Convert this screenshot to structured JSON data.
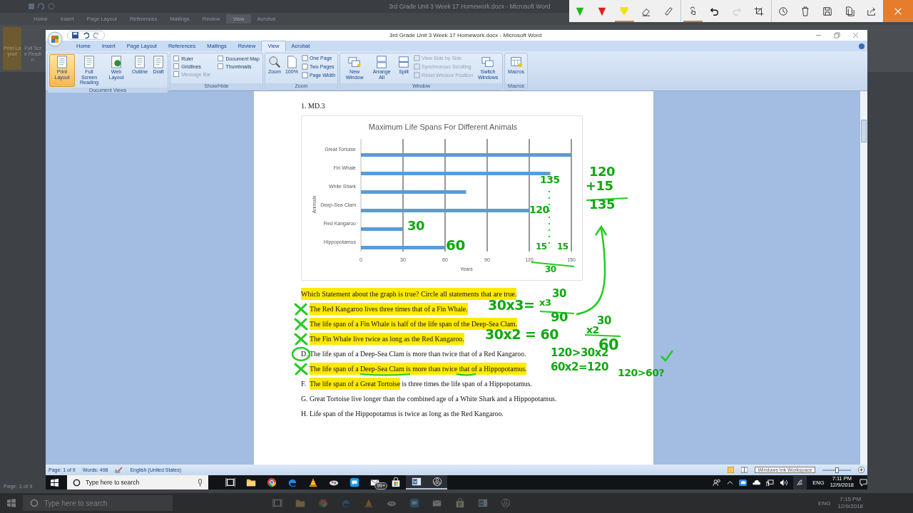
{
  "background": {
    "title": "3rd Grade Unit 3 Week 17 Homework.docx - Microsoft Word",
    "tabs": [
      {
        "label": "Home",
        "selected": false
      },
      {
        "label": "Insert",
        "selected": false
      },
      {
        "label": "Page Layout",
        "selected": false
      },
      {
        "label": "References",
        "selected": false
      },
      {
        "label": "Mailings",
        "selected": false
      },
      {
        "label": "Review",
        "selected": false
      },
      {
        "label": "View",
        "selected": true
      },
      {
        "label": "Acrobat",
        "selected": false
      }
    ],
    "ribbon_buttons": [
      {
        "label": "Print Layout",
        "selected": true
      },
      {
        "label": "Full Scre Readin",
        "selected": false
      }
    ],
    "status": "Page: 1 of 9",
    "search_placeholder": "Type here to search",
    "language": "ENG",
    "time": "7:15 PM",
    "date": "12/9/2018"
  },
  "ink_toolbar": {
    "tools": [
      {
        "kind": "pen",
        "color": "#1fb81f",
        "selected": false
      },
      {
        "kind": "pen",
        "color": "#d9201c",
        "selected": false
      },
      {
        "kind": "highlighter",
        "color": "#f2e400",
        "selected": true
      },
      {
        "kind": "eraser",
        "selected": false
      },
      {
        "kind": "ruler",
        "selected": false
      },
      {
        "kind": "touch",
        "selected": true
      },
      {
        "kind": "undo",
        "disabled": false
      },
      {
        "kind": "redo",
        "disabled": true
      },
      {
        "kind": "crop",
        "selected": false
      },
      {
        "kind": "history",
        "selected": false
      },
      {
        "kind": "delete",
        "selected": false
      },
      {
        "kind": "save",
        "selected": false
      },
      {
        "kind": "copy",
        "selected": false
      },
      {
        "kind": "share",
        "selected": false
      },
      {
        "kind": "close"
      }
    ]
  },
  "word_window": {
    "title": "3rd Grade Unit 3 Week 17 Homework.docx - Microsoft Word",
    "tabs": [
      {
        "label": "Home",
        "selected": false
      },
      {
        "label": "Insert",
        "selected": false
      },
      {
        "label": "Page Layout",
        "selected": false
      },
      {
        "label": "References",
        "selected": false
      },
      {
        "label": "Mailings",
        "selected": false
      },
      {
        "label": "Review",
        "selected": false
      },
      {
        "label": "View",
        "selected": true
      },
      {
        "label": "Acrobat",
        "selected": false
      }
    ],
    "ribbon": {
      "document_views": {
        "label": "Document Views",
        "buttons": [
          {
            "label": "Print Layout",
            "selected": true
          },
          {
            "label": "Full Screen Reading",
            "selected": false
          },
          {
            "label": "Web Layout",
            "selected": false
          },
          {
            "label": "Outline",
            "selected": false
          },
          {
            "label": "Draft",
            "selected": false
          }
        ]
      },
      "show_hide": {
        "label": "Show/Hide",
        "options": [
          {
            "label": "Ruler",
            "checked": false,
            "disabled": false
          },
          {
            "label": "Gridlines",
            "checked": false,
            "disabled": false
          },
          {
            "label": "Message Bar",
            "checked": false,
            "disabled": true
          },
          {
            "label": "Document Map",
            "checked": false,
            "disabled": false
          },
          {
            "label": "Thumbnails",
            "checked": false,
            "disabled": false
          }
        ]
      },
      "zoom": {
        "label": "Zoom",
        "buttons": [
          "Zoom",
          "100%"
        ],
        "small_buttons": [
          "One Page",
          "Two Pages",
          "Page Width"
        ]
      },
      "window": {
        "label": "Window",
        "buttons": [
          "New Window",
          "Arrange All",
          "Split"
        ],
        "small_buttons": [
          {
            "label": "View Side by Side",
            "disabled": true
          },
          {
            "label": "Synchronous Scrolling",
            "disabled": true
          },
          {
            "label": "Reset Window Position",
            "disabled": true
          }
        ],
        "switch_button": "Switch Windows"
      },
      "macros": {
        "label": "Macros",
        "button": "Macros"
      }
    },
    "document": {
      "heading": "1. MD.3",
      "chart": {
        "chart_data": {
          "type": "bar",
          "orientation": "horizontal",
          "title": "Maximum Life Spans For Different  Animals",
          "xlabel": "Years",
          "ylabel": "Animals",
          "categories": [
            "Great Tortoise",
            "Fin Whale",
            "White Shark",
            "Deep-Sea Clam",
            "Red Kangaroo",
            "Hippopotamus"
          ],
          "values": [
            150,
            135,
            75,
            120,
            30,
            60
          ],
          "xlim": [
            0,
            150
          ],
          "xticks": [
            0,
            30,
            60,
            90,
            120,
            150
          ],
          "grid": true
        }
      },
      "question": "Which Statement about the graph is true? Circle all statements that are true.",
      "statements": [
        {
          "crossed": true,
          "circled": false,
          "segments": [
            {
              "text": "The Red Kangaroo lives three times that of a Fin Whale.",
              "highlighted": true
            }
          ]
        },
        {
          "crossed": true,
          "circled": false,
          "segments": [
            {
              "text": "The life span of a Fin Whale is half of the life span of the Deep-Sea Clam.",
              "highlighted": true
            }
          ]
        },
        {
          "crossed": true,
          "circled": false,
          "segments": [
            {
              "text": "The Fin Whale live twice as long as the Red Kangaroo.",
              "highlighted": true
            }
          ]
        },
        {
          "label": "D.",
          "crossed": false,
          "circled": true,
          "segments": [
            {
              "text": "The life span of a Deep-Sea Clam is more than twice that of a Red Kangaroo.",
              "highlighted": false
            }
          ]
        },
        {
          "crossed": true,
          "circled": false,
          "segments": [
            {
              "text": "The life span of a Deep-Sea Clam is more than twice that of a Hippopotamus.",
              "highlighted": true
            }
          ]
        },
        {
          "label": "F.",
          "crossed": false,
          "circled": false,
          "segments": [
            {
              "text": "The life span of a Great Tortoise",
              "highlighted": true
            },
            {
              "text": " is three times the life span of a Hippopotamus.",
              "highlighted": false
            }
          ]
        },
        {
          "label": "G.",
          "crossed": false,
          "circled": false,
          "segments": [
            {
              "text": "Great Tortoise live longer than the combined age of a White Shark and a Hippopotamus.",
              "highlighted": false
            }
          ]
        },
        {
          "label": "H.",
          "crossed": false,
          "circled": false,
          "segments": [
            {
              "text": "Life span of the Hippopotamus is twice as long as the Red Kangaroo.",
              "highlighted": false
            }
          ]
        }
      ]
    },
    "status_bar": {
      "page": "Page: 1 of 9",
      "words": "Words: 498",
      "language": "English (United States)",
      "tooltip": "Windows Ink Workspace",
      "zoom_slider": {
        "level": 0.5
      }
    }
  },
  "ink_notes": [
    "120",
    "+15",
    "135",
    "135",
    "120",
    "30",
    "60",
    "15",
    "15",
    "30",
    "30x3=",
    "30",
    "x3",
    "90",
    "30",
    "x2",
    "60",
    "30x2 = 60",
    "120>30x2",
    "60x2=120",
    "120>60?"
  ],
  "taskbar": {
    "search_placeholder": "Type here to search",
    "apps": [
      {
        "kind": "task-view",
        "active": false
      },
      {
        "kind": "folder",
        "active": false
      },
      {
        "kind": "chrome",
        "active": false
      },
      {
        "kind": "edge",
        "active": false
      },
      {
        "kind": "vlc",
        "active": false
      },
      {
        "kind": "paint",
        "active": false
      },
      {
        "kind": "chat",
        "active": false
      },
      {
        "kind": "mail",
        "active": false,
        "badge": "99+"
      },
      {
        "kind": "store",
        "active": false
      },
      {
        "kind": "word",
        "active": true
      },
      {
        "kind": "obs",
        "active": true
      }
    ],
    "language": "ENG",
    "time": "7:11 PM",
    "date": "12/9/2018"
  }
}
